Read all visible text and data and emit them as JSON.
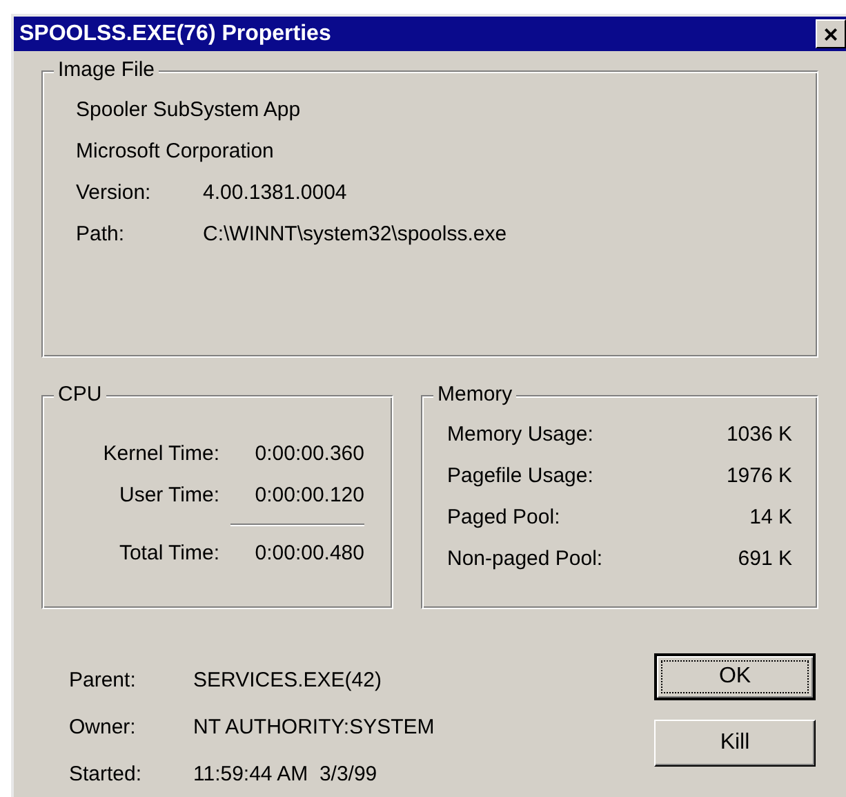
{
  "window": {
    "title": "SPOOLSS.EXE(76) Properties",
    "close": "×"
  },
  "image_file": {
    "title": "Image File",
    "description": "Spooler SubSystem App",
    "company": "Microsoft Corporation",
    "fields": [
      {
        "label": "Version:",
        "value": "4.00.1381.0004"
      },
      {
        "label": "Path:",
        "value": "C:\\WINNT\\system32\\spoolss.exe"
      }
    ]
  },
  "cpu": {
    "title": "CPU",
    "rows": [
      {
        "label": "Kernel Time:",
        "value": "0:00:00.360"
      },
      {
        "label": "User Time:",
        "value": "0:00:00.120"
      }
    ],
    "total": {
      "label": "Total Time:",
      "value": "0:00:00.480"
    }
  },
  "memory": {
    "title": "Memory",
    "rows": [
      {
        "label": "Memory Usage:",
        "value": "1036 K"
      },
      {
        "label": "Pagefile Usage:",
        "value": "1976 K"
      },
      {
        "label": "Paged Pool:",
        "value": "14 K"
      },
      {
        "label": "Non-paged Pool:",
        "value": "691 K"
      }
    ]
  },
  "details": [
    {
      "label": "Parent:",
      "value": "SERVICES.EXE(42)"
    },
    {
      "label": "Owner:",
      "value": "NT AUTHORITY:SYSTEM"
    },
    {
      "label": "Started:",
      "value": "11:59:44 AM  3/3/99"
    }
  ],
  "buttons": [
    {
      "label": "OK",
      "default": true
    },
    {
      "label": "Kill",
      "default": false
    }
  ]
}
